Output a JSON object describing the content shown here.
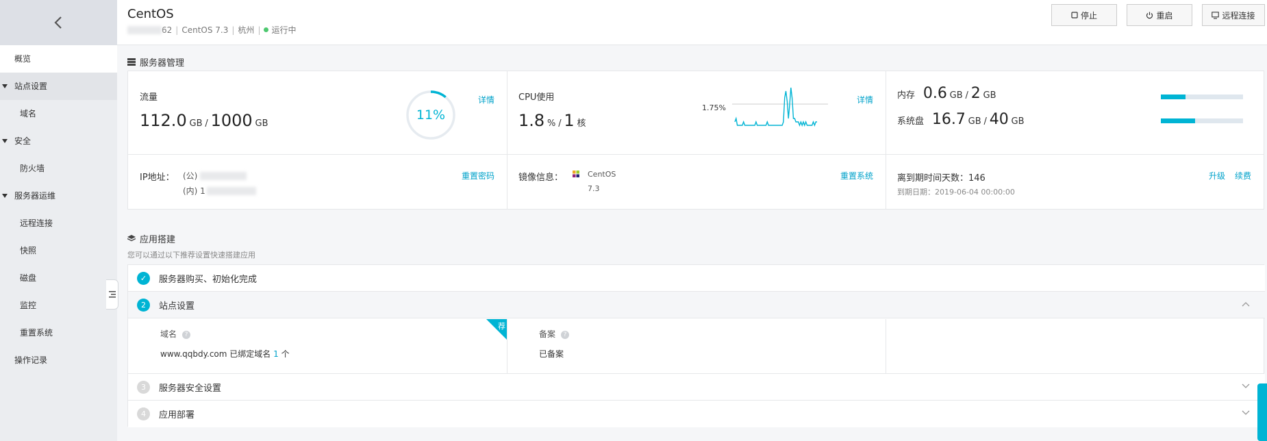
{
  "sidebar": {
    "items": [
      {
        "label": "概览",
        "kind": "top",
        "active": true
      },
      {
        "label": "站点设置",
        "kind": "group"
      },
      {
        "label": "域名",
        "kind": "sub"
      },
      {
        "label": "安全",
        "kind": "group"
      },
      {
        "label": "防火墙",
        "kind": "sub"
      },
      {
        "label": "服务器运维",
        "kind": "group"
      },
      {
        "label": "远程连接",
        "kind": "sub"
      },
      {
        "label": "快照",
        "kind": "sub"
      },
      {
        "label": "磁盘",
        "kind": "sub"
      },
      {
        "label": "监控",
        "kind": "sub"
      },
      {
        "label": "重置系统",
        "kind": "sub"
      },
      {
        "label": "操作记录",
        "kind": "top"
      }
    ]
  },
  "header": {
    "title": "CentOS",
    "ip_suffix": "62",
    "os": "CentOS 7.3",
    "region": "杭州",
    "status": "运行中",
    "status_color": "#4dc86f",
    "buttons": {
      "stop": "停止",
      "restart": "重启",
      "remote": "远程连接"
    }
  },
  "server": {
    "section_title": "服务器管理",
    "traffic": {
      "label": "流量",
      "used": "112.0",
      "used_unit": "GB",
      "slash": "/",
      "total": "1000",
      "total_unit": "GB",
      "percent_text": "11%",
      "percent": 11,
      "detail": "详情"
    },
    "cpu": {
      "label": "CPU使用",
      "value": "1.8",
      "unit": "%",
      "slash": "/",
      "cores": "1",
      "cores_unit": "核",
      "peak_label": "1.75%",
      "detail": "详情",
      "series": [
        2,
        3,
        1,
        1,
        1,
        1,
        1,
        2,
        1,
        1,
        1,
        1,
        1,
        1,
        1,
        1,
        1,
        2,
        1,
        1,
        1,
        1,
        1,
        1,
        1,
        1,
        2,
        1,
        1,
        1,
        1,
        1,
        1,
        1,
        1,
        1,
        1,
        1,
        1,
        2,
        9,
        11,
        8,
        3,
        7,
        12,
        9,
        3,
        3,
        2,
        2,
        2,
        1,
        2,
        1,
        2,
        1,
        2,
        1,
        1,
        1,
        1,
        1,
        2,
        1,
        2,
        2
      ],
      "series_max": 12
    },
    "memory": {
      "label": "内存",
      "used": "0.6",
      "used_unit": "GB",
      "slash": "/",
      "total": "2",
      "total_unit": "GB",
      "fraction": 0.3
    },
    "disk": {
      "label": "系统盘",
      "used": "16.7",
      "used_unit": "GB",
      "slash": "/",
      "total": "40",
      "total_unit": "GB",
      "fraction": 0.42
    },
    "ip": {
      "label": "IP地址：",
      "public_prefix": "(公)",
      "private_prefix": "(内) 1",
      "reset_pwd": "重置密码"
    },
    "image": {
      "label": "镜像信息：",
      "name": "CentOS",
      "version": "7.3",
      "reset_sys": "重置系统"
    },
    "expire": {
      "label": "离到期时间天数：",
      "days": "146",
      "date_label": "到期日期：",
      "date": "2019-06-04 00:00:00",
      "upgrade": "升级",
      "renew": "续费"
    }
  },
  "app": {
    "section_title": "应用搭建",
    "subtitle": "您可以通过以下推荐设置快速搭建应用",
    "steps": [
      {
        "num": "✓",
        "label": "服务器购买、初始化完成",
        "state": "done"
      },
      {
        "num": "2",
        "label": "站点设置",
        "state": "active"
      },
      {
        "num": "3",
        "label": "服务器安全设置",
        "state": "pending"
      },
      {
        "num": "4",
        "label": "应用部署",
        "state": "pending"
      }
    ],
    "site": {
      "domain_label": "域名",
      "domain_value": "www.qqbdy.com 已绑定域名",
      "domain_count": "1",
      "domain_count_unit": "个",
      "recommend_badge": "荐",
      "record_label": "备案",
      "record_value": "已备案"
    }
  }
}
